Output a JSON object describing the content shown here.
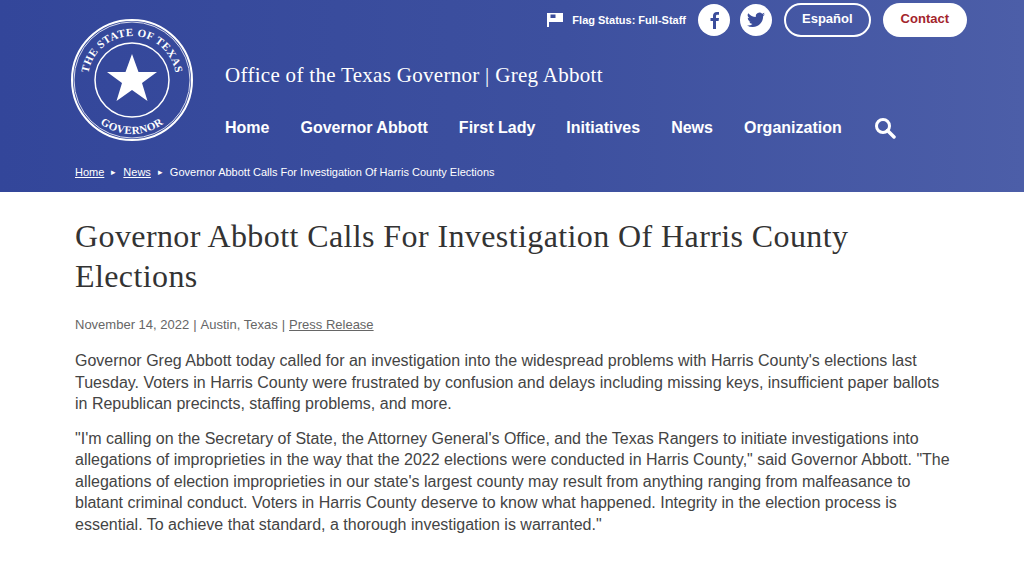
{
  "header": {
    "seal": {
      "top": "THE STATE OF TEXAS",
      "bottom": "GOVERNOR"
    },
    "site_title": "Office of the Texas Governor | Greg Abbott",
    "flag_status": "Flag Status: Full-Staff",
    "language_button": "Español",
    "contact_button": "Contact"
  },
  "nav": [
    {
      "label": "Home",
      "selected": false
    },
    {
      "label": "Governor Abbott",
      "selected": false
    },
    {
      "label": "First Lady",
      "selected": false
    },
    {
      "label": "Initiatives",
      "selected": false
    },
    {
      "label": "News",
      "selected": false
    },
    {
      "label": "Organization",
      "selected": false
    }
  ],
  "breadcrumb": {
    "separator": "▸",
    "items": [
      {
        "label": "Home",
        "link": true
      },
      {
        "label": "News",
        "link": true
      },
      {
        "label": "Governor Abbott Calls For Investigation Of Harris County Elections",
        "link": false
      }
    ]
  },
  "article": {
    "title": "Governor Abbott Calls For Investigation Of Harris County Elections",
    "meta": {
      "date": "November 14, 2022",
      "place": "Austin, Texas",
      "category": "Press Release",
      "separator": "|"
    },
    "paragraphs": [
      "Governor Greg Abbott today called for an investigation into the widespread problems with Harris County's elections last Tuesday. Voters in Harris County were frustrated by confusion and delays including missing keys, insufficient paper ballots in Republican precincts, staffing problems, and more.",
      "\"I'm calling on the Secretary of State, the Attorney General's Office, and the Texas Rangers to initiate investigations into allegations of improprieties in the way that the 2022 elections were conducted in Harris County,\" said Governor Abbott. \"The allegations of election improprieties in our state's largest county may result from anything ranging from malfeasance to blatant criminal conduct. Voters in Harris County deserve to know what happened. Integrity in the election process is essential. To achieve that standard, a thorough investigation is warranted.\""
    ]
  }
}
